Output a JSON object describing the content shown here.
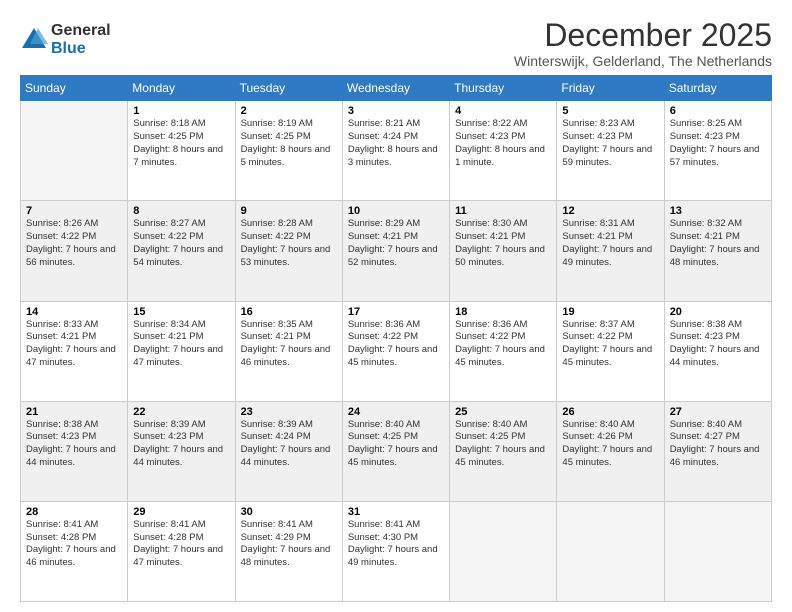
{
  "logo": {
    "general": "General",
    "blue": "Blue"
  },
  "title": "December 2025",
  "subtitle": "Winterswijk, Gelderland, The Netherlands",
  "days_of_week": [
    "Sunday",
    "Monday",
    "Tuesday",
    "Wednesday",
    "Thursday",
    "Friday",
    "Saturday"
  ],
  "weeks": [
    [
      {
        "num": "",
        "empty": true
      },
      {
        "num": "1",
        "sunrise": "Sunrise: 8:18 AM",
        "sunset": "Sunset: 4:25 PM",
        "daylight": "Daylight: 8 hours and 7 minutes."
      },
      {
        "num": "2",
        "sunrise": "Sunrise: 8:19 AM",
        "sunset": "Sunset: 4:25 PM",
        "daylight": "Daylight: 8 hours and 5 minutes."
      },
      {
        "num": "3",
        "sunrise": "Sunrise: 8:21 AM",
        "sunset": "Sunset: 4:24 PM",
        "daylight": "Daylight: 8 hours and 3 minutes."
      },
      {
        "num": "4",
        "sunrise": "Sunrise: 8:22 AM",
        "sunset": "Sunset: 4:23 PM",
        "daylight": "Daylight: 8 hours and 1 minute."
      },
      {
        "num": "5",
        "sunrise": "Sunrise: 8:23 AM",
        "sunset": "Sunset: 4:23 PM",
        "daylight": "Daylight: 7 hours and 59 minutes."
      },
      {
        "num": "6",
        "sunrise": "Sunrise: 8:25 AM",
        "sunset": "Sunset: 4:23 PM",
        "daylight": "Daylight: 7 hours and 57 minutes."
      }
    ],
    [
      {
        "num": "7",
        "sunrise": "Sunrise: 8:26 AM",
        "sunset": "Sunset: 4:22 PM",
        "daylight": "Daylight: 7 hours and 56 minutes."
      },
      {
        "num": "8",
        "sunrise": "Sunrise: 8:27 AM",
        "sunset": "Sunset: 4:22 PM",
        "daylight": "Daylight: 7 hours and 54 minutes."
      },
      {
        "num": "9",
        "sunrise": "Sunrise: 8:28 AM",
        "sunset": "Sunset: 4:22 PM",
        "daylight": "Daylight: 7 hours and 53 minutes."
      },
      {
        "num": "10",
        "sunrise": "Sunrise: 8:29 AM",
        "sunset": "Sunset: 4:21 PM",
        "daylight": "Daylight: 7 hours and 52 minutes."
      },
      {
        "num": "11",
        "sunrise": "Sunrise: 8:30 AM",
        "sunset": "Sunset: 4:21 PM",
        "daylight": "Daylight: 7 hours and 50 minutes."
      },
      {
        "num": "12",
        "sunrise": "Sunrise: 8:31 AM",
        "sunset": "Sunset: 4:21 PM",
        "daylight": "Daylight: 7 hours and 49 minutes."
      },
      {
        "num": "13",
        "sunrise": "Sunrise: 8:32 AM",
        "sunset": "Sunset: 4:21 PM",
        "daylight": "Daylight: 7 hours and 48 minutes."
      }
    ],
    [
      {
        "num": "14",
        "sunrise": "Sunrise: 8:33 AM",
        "sunset": "Sunset: 4:21 PM",
        "daylight": "Daylight: 7 hours and 47 minutes."
      },
      {
        "num": "15",
        "sunrise": "Sunrise: 8:34 AM",
        "sunset": "Sunset: 4:21 PM",
        "daylight": "Daylight: 7 hours and 47 minutes."
      },
      {
        "num": "16",
        "sunrise": "Sunrise: 8:35 AM",
        "sunset": "Sunset: 4:21 PM",
        "daylight": "Daylight: 7 hours and 46 minutes."
      },
      {
        "num": "17",
        "sunrise": "Sunrise: 8:36 AM",
        "sunset": "Sunset: 4:22 PM",
        "daylight": "Daylight: 7 hours and 45 minutes."
      },
      {
        "num": "18",
        "sunrise": "Sunrise: 8:36 AM",
        "sunset": "Sunset: 4:22 PM",
        "daylight": "Daylight: 7 hours and 45 minutes."
      },
      {
        "num": "19",
        "sunrise": "Sunrise: 8:37 AM",
        "sunset": "Sunset: 4:22 PM",
        "daylight": "Daylight: 7 hours and 45 minutes."
      },
      {
        "num": "20",
        "sunrise": "Sunrise: 8:38 AM",
        "sunset": "Sunset: 4:23 PM",
        "daylight": "Daylight: 7 hours and 44 minutes."
      }
    ],
    [
      {
        "num": "21",
        "sunrise": "Sunrise: 8:38 AM",
        "sunset": "Sunset: 4:23 PM",
        "daylight": "Daylight: 7 hours and 44 minutes."
      },
      {
        "num": "22",
        "sunrise": "Sunrise: 8:39 AM",
        "sunset": "Sunset: 4:23 PM",
        "daylight": "Daylight: 7 hours and 44 minutes."
      },
      {
        "num": "23",
        "sunrise": "Sunrise: 8:39 AM",
        "sunset": "Sunset: 4:24 PM",
        "daylight": "Daylight: 7 hours and 44 minutes."
      },
      {
        "num": "24",
        "sunrise": "Sunrise: 8:40 AM",
        "sunset": "Sunset: 4:25 PM",
        "daylight": "Daylight: 7 hours and 45 minutes."
      },
      {
        "num": "25",
        "sunrise": "Sunrise: 8:40 AM",
        "sunset": "Sunset: 4:25 PM",
        "daylight": "Daylight: 7 hours and 45 minutes."
      },
      {
        "num": "26",
        "sunrise": "Sunrise: 8:40 AM",
        "sunset": "Sunset: 4:26 PM",
        "daylight": "Daylight: 7 hours and 45 minutes."
      },
      {
        "num": "27",
        "sunrise": "Sunrise: 8:40 AM",
        "sunset": "Sunset: 4:27 PM",
        "daylight": "Daylight: 7 hours and 46 minutes."
      }
    ],
    [
      {
        "num": "28",
        "sunrise": "Sunrise: 8:41 AM",
        "sunset": "Sunset: 4:28 PM",
        "daylight": "Daylight: 7 hours and 46 minutes."
      },
      {
        "num": "29",
        "sunrise": "Sunrise: 8:41 AM",
        "sunset": "Sunset: 4:28 PM",
        "daylight": "Daylight: 7 hours and 47 minutes."
      },
      {
        "num": "30",
        "sunrise": "Sunrise: 8:41 AM",
        "sunset": "Sunset: 4:29 PM",
        "daylight": "Daylight: 7 hours and 48 minutes."
      },
      {
        "num": "31",
        "sunrise": "Sunrise: 8:41 AM",
        "sunset": "Sunset: 4:30 PM",
        "daylight": "Daylight: 7 hours and 49 minutes."
      },
      {
        "num": "",
        "empty": true
      },
      {
        "num": "",
        "empty": true
      },
      {
        "num": "",
        "empty": true
      }
    ]
  ]
}
